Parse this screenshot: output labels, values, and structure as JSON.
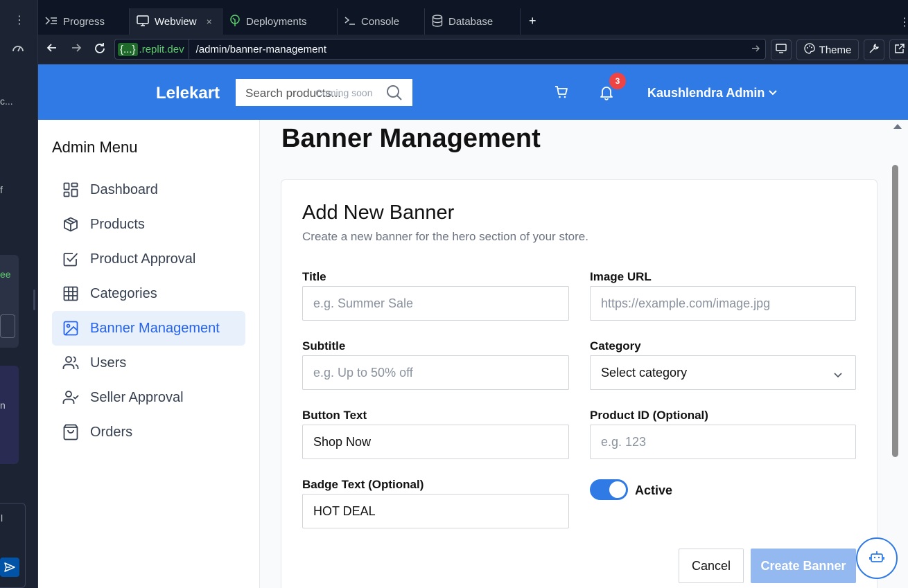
{
  "ide": {
    "tabs": [
      {
        "label": "Progress",
        "icon": "progress-icon"
      },
      {
        "label": "Webview",
        "icon": "monitor-icon",
        "active": true
      },
      {
        "label": "Deployments",
        "icon": "deploy-icon"
      },
      {
        "label": "Console",
        "icon": "terminal-icon"
      },
      {
        "label": "Database",
        "icon": "database-icon"
      }
    ],
    "close_symbol": "×",
    "add_tab_symbol": "+",
    "url": {
      "host_prefix": "{...}",
      "host_domain": ".replit.dev",
      "path": "/admin/banner-management"
    },
    "theme_label": "Theme",
    "left_fragments": [
      "c...",
      "f",
      "ee",
      "n",
      "l"
    ]
  },
  "site": {
    "brand": "Lelekart",
    "search_placeholder": "Search products...",
    "search_badge": "Coming soon",
    "notification_count": "3",
    "user_name": "Kaushlendra Admin",
    "colors": {
      "header": "#2f7ae5",
      "accent": "#2563eb",
      "badge": "#ef4444"
    }
  },
  "sidebar": {
    "title": "Admin Menu",
    "items": [
      {
        "label": "Dashboard",
        "icon": "dashboard-icon"
      },
      {
        "label": "Products",
        "icon": "box-icon"
      },
      {
        "label": "Product Approval",
        "icon": "checkbox-icon"
      },
      {
        "label": "Categories",
        "icon": "grid-icon"
      },
      {
        "label": "Banner Management",
        "icon": "image-icon",
        "active": true
      },
      {
        "label": "Users",
        "icon": "users-icon"
      },
      {
        "label": "Seller Approval",
        "icon": "user-check-icon"
      },
      {
        "label": "Orders",
        "icon": "shopping-bag-icon"
      }
    ]
  },
  "main": {
    "page_title": "Banner Management",
    "card": {
      "title": "Add New Banner",
      "description": "Create a new banner for the hero section of your store.",
      "fields": {
        "title": {
          "label": "Title",
          "placeholder": "e.g. Summer Sale",
          "value": ""
        },
        "image_url": {
          "label": "Image URL",
          "placeholder": "https://example.com/image.jpg",
          "value": ""
        },
        "subtitle": {
          "label": "Subtitle",
          "placeholder": "e.g. Up to 50% off",
          "value": ""
        },
        "category": {
          "label": "Category",
          "selected": "Select category"
        },
        "button_text": {
          "label": "Button Text",
          "placeholder": "",
          "value": "Shop Now"
        },
        "product_id": {
          "label": "Product ID (Optional)",
          "placeholder": "e.g. 123",
          "value": ""
        },
        "badge_text": {
          "label": "Badge Text (Optional)",
          "placeholder": "",
          "value": "HOT DEAL"
        }
      },
      "active_toggle": {
        "label": "Active",
        "on": true
      },
      "cancel_label": "Cancel",
      "create_label": "Create Banner"
    }
  }
}
